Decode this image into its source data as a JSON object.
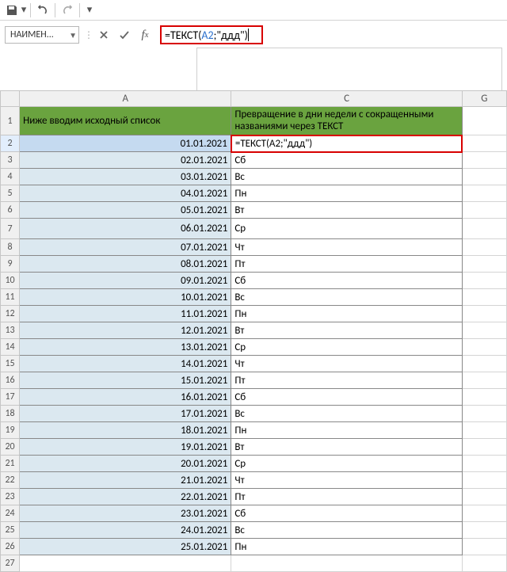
{
  "qat": {
    "save_icon": "save-icon",
    "undo_icon": "undo-icon",
    "redo_icon": "redo-icon"
  },
  "namebox": {
    "value": "НАИМЕН..."
  },
  "formula_bar": {
    "prefix": "=ТЕКСТ(",
    "ref": "A2",
    "suffix": ";\"ддд\")"
  },
  "columns": {
    "A": "A",
    "C": "C",
    "G": "G"
  },
  "headers": {
    "A": "Ниже вводим исходный список",
    "C": "Превращение в дни недели с сокращенными названиями через ТЕКСТ"
  },
  "edit_cell": "=ТЕКСТ(A2;\"ддд\")",
  "rows": [
    {
      "n": 2,
      "date": "01.01.2021",
      "day": ""
    },
    {
      "n": 3,
      "date": "02.01.2021",
      "day": "Сб"
    },
    {
      "n": 4,
      "date": "03.01.2021",
      "day": "Вс"
    },
    {
      "n": 5,
      "date": "04.01.2021",
      "day": "Пн"
    },
    {
      "n": 6,
      "date": "05.01.2021",
      "day": "Вт"
    },
    {
      "n": 7,
      "date": "06.01.2021",
      "day": "Ср"
    },
    {
      "n": 8,
      "date": "07.01.2021",
      "day": "Чт"
    },
    {
      "n": 9,
      "date": "08.01.2021",
      "day": "Пт"
    },
    {
      "n": 10,
      "date": "09.01.2021",
      "day": "Сб"
    },
    {
      "n": 11,
      "date": "10.01.2021",
      "day": "Вс"
    },
    {
      "n": 12,
      "date": "11.01.2021",
      "day": "Пн"
    },
    {
      "n": 13,
      "date": "12.01.2021",
      "day": "Вт"
    },
    {
      "n": 14,
      "date": "13.01.2021",
      "day": "Ср"
    },
    {
      "n": 15,
      "date": "14.01.2021",
      "day": "Чт"
    },
    {
      "n": 16,
      "date": "15.01.2021",
      "day": "Пт"
    },
    {
      "n": 17,
      "date": "16.01.2021",
      "day": "Сб"
    },
    {
      "n": 18,
      "date": "17.01.2021",
      "day": "Вс"
    },
    {
      "n": 19,
      "date": "18.01.2021",
      "day": "Пн"
    },
    {
      "n": 20,
      "date": "19.01.2021",
      "day": "Вт"
    },
    {
      "n": 21,
      "date": "20.01.2021",
      "day": "Ср"
    },
    {
      "n": 22,
      "date": "21.01.2021",
      "day": "Чт"
    },
    {
      "n": 23,
      "date": "22.01.2021",
      "day": "Пт"
    },
    {
      "n": 24,
      "date": "23.01.2021",
      "day": "Сб"
    },
    {
      "n": 25,
      "date": "24.01.2021",
      "day": "Вс"
    },
    {
      "n": 26,
      "date": "25.01.2021",
      "day": "Пн"
    }
  ],
  "last_empty_row": 27
}
